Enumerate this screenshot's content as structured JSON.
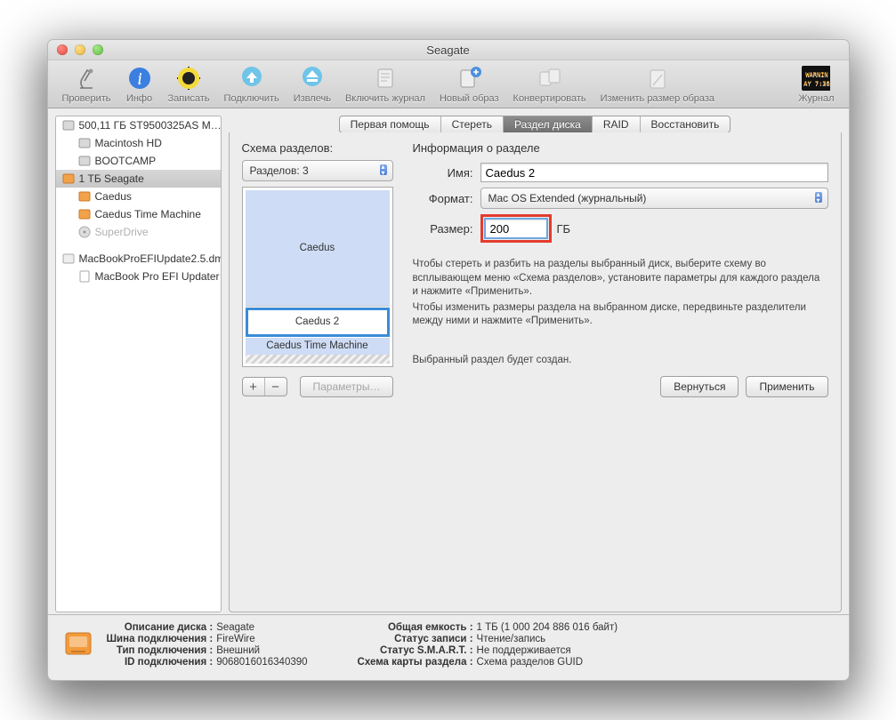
{
  "window": {
    "title": "Seagate"
  },
  "toolbar": {
    "items": [
      {
        "name": "verify",
        "label": "Проверить"
      },
      {
        "name": "info",
        "label": "Инфо"
      },
      {
        "name": "burn",
        "label": "Записать"
      },
      {
        "name": "mount",
        "label": "Подключить"
      },
      {
        "name": "eject",
        "label": "Извлечь"
      },
      {
        "name": "journal",
        "label": "Включить журнал"
      },
      {
        "name": "newimage",
        "label": "Новый образ"
      },
      {
        "name": "convert",
        "label": "Конвертировать"
      },
      {
        "name": "resize",
        "label": "Изменить размер образа"
      }
    ],
    "log_label": "Журнал"
  },
  "sidebar": {
    "groups": [
      {
        "icon": "hdd",
        "indent": 0,
        "label": "500,11 ГБ ST9500325AS M…",
        "dim": false
      },
      {
        "icon": "hdd",
        "indent": 18,
        "label": "Macintosh HD",
        "dim": false
      },
      {
        "icon": "hdd",
        "indent": 18,
        "label": "BOOTCAMP",
        "dim": false
      },
      {
        "icon": "ext",
        "indent": 0,
        "label": "1 ТБ Seagate",
        "dim": false,
        "selected": true
      },
      {
        "icon": "ext",
        "indent": 18,
        "label": "Caedus",
        "dim": false
      },
      {
        "icon": "ext",
        "indent": 18,
        "label": "Caedus Time Machine",
        "dim": false
      },
      {
        "icon": "opt",
        "indent": 18,
        "label": "SuperDrive",
        "dim": true
      },
      {
        "icon": "",
        "indent": 0,
        "label": "",
        "dim": false,
        "spacer": true
      },
      {
        "icon": "dmg",
        "indent": 0,
        "label": "MacBookProEFIUpdate2.5.dm",
        "dim": false
      },
      {
        "icon": "doc",
        "indent": 18,
        "label": "MacBook Pro EFI Updater",
        "dim": false
      }
    ]
  },
  "tabs": {
    "items": [
      "Первая помощь",
      "Стереть",
      "Раздел диска",
      "RAID",
      "Восстановить"
    ],
    "active": 2
  },
  "scheme": {
    "heading": "Схема разделов:",
    "popup": "Разделов: 3",
    "partitions": [
      "Caedus",
      "Caedus 2",
      "Caedus Time Machine"
    ]
  },
  "info": {
    "heading": "Информация о разделе",
    "name_label": "Имя:",
    "name_value": "Caedus 2",
    "format_label": "Формат:",
    "format_value": "Mac OS Extended (журнальный)",
    "size_label": "Размер:",
    "size_value": "200",
    "size_unit": "ГБ",
    "help1": "Чтобы стереть и разбить на разделы выбранный диск, выберите схему во всплывающем меню «Схема разделов», установите параметры для каждого раздела и нажмите «Применить».",
    "help2": "Чтобы изменить размеры раздела на выбранном диске, передвиньте разделители между ними и нажмите «Применить».",
    "pending": "Выбранный раздел будет создан."
  },
  "buttons": {
    "options": "Параметры…",
    "revert": "Вернуться",
    "apply": "Применить"
  },
  "footer": {
    "left": {
      "k1": "Описание диска",
      "v1": "Seagate",
      "k2": "Шина подключения",
      "v2": "FireWire",
      "k3": "Тип подключения",
      "v3": "Внешний",
      "k4": "ID подключения",
      "v4": "9068016016340390"
    },
    "right": {
      "k1": "Общая емкость",
      "v1": "1 ТБ (1 000 204 886 016 байт)",
      "k2": "Статус записи",
      "v2": "Чтение/запись",
      "k3": "Статус S.M.A.R.T.",
      "v3": "Не поддерживается",
      "k4": "Схема карты раздела",
      "v4": "Схема разделов GUID"
    }
  }
}
